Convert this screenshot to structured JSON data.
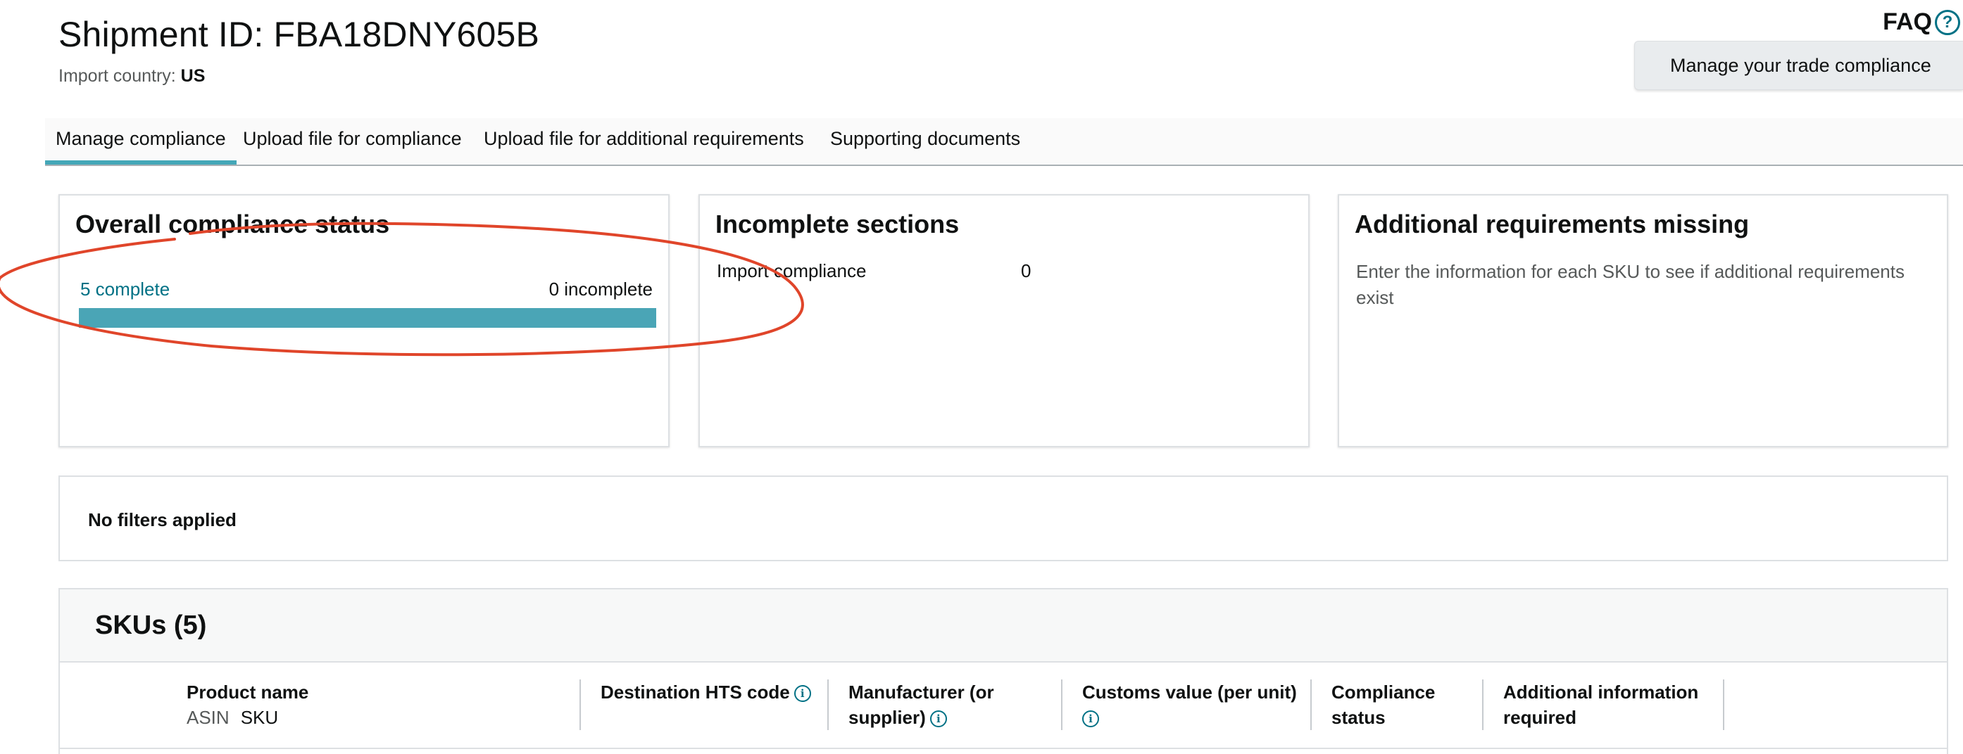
{
  "header": {
    "title": "Shipment ID: FBA18DNY605B",
    "import_country_label": "Import country: ",
    "import_country_value": "US",
    "faq_label": "FAQ",
    "faq_icon": "?",
    "trade_button": "Manage your trade compliance"
  },
  "tabs": [
    {
      "label": "Manage compliance",
      "active": true
    },
    {
      "label": "Upload file for compliance",
      "active": false
    },
    {
      "label": "Upload file for additional requirements",
      "active": false
    },
    {
      "label": "Supporting documents",
      "active": false
    }
  ],
  "cards": {
    "overall": {
      "title": "Overall compliance status",
      "complete_label": "5 complete",
      "incomplete_label": "0 incomplete",
      "progress_fraction": 1.0
    },
    "incomplete_sections": {
      "title": "Incomplete sections",
      "row_label": "Import compliance",
      "row_value": "0"
    },
    "additional": {
      "title": "Additional requirements missing",
      "text": "Enter the information for each SKU to see if additional requirements exist"
    }
  },
  "filters": {
    "label": "No filters applied"
  },
  "skus": {
    "title": "SKUs (5)",
    "columns": {
      "product_name": "Product name",
      "asin": "ASIN",
      "sku": "SKU",
      "hts": "Destination HTS code",
      "manufacturer_1": "Manufacturer (or",
      "manufacturer_2": "supplier)",
      "customs": "Customs value (per unit)",
      "compliance_1": "Compliance",
      "compliance_2": "status",
      "additional_1": "Additional information",
      "additional_2": "required"
    },
    "info_icon": "i"
  },
  "colors": {
    "accent_teal": "#44a7b8",
    "link": "#007185",
    "annotation": "#e0452a"
  }
}
